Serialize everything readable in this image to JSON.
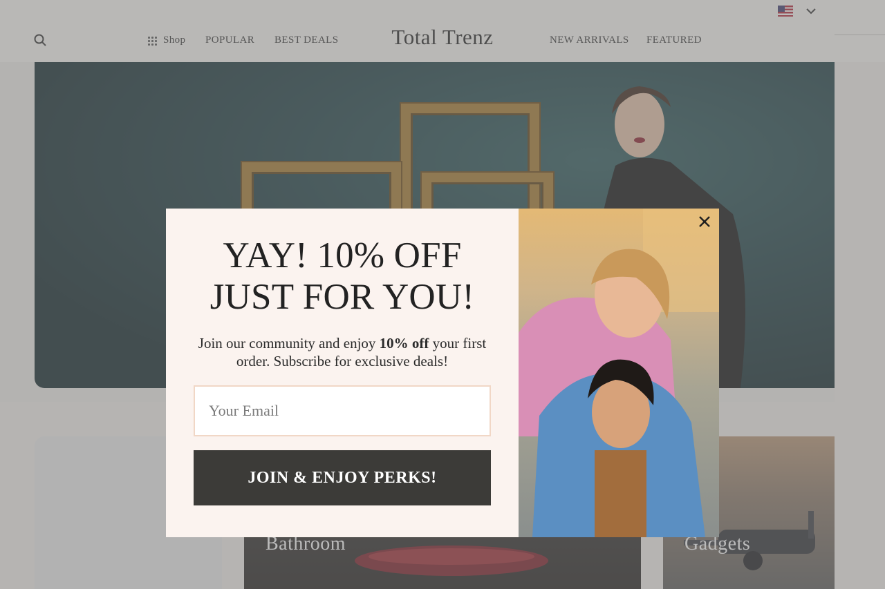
{
  "header": {
    "brand": "Total Trenz",
    "nav_left": [
      {
        "label": "Shop",
        "icon": "grid-icon"
      },
      {
        "label": "POPULAR"
      },
      {
        "label": "BEST DEALS"
      }
    ],
    "nav_right": [
      {
        "label": "NEW ARRIVALS"
      },
      {
        "label": "FEATURED"
      }
    ],
    "search_icon": "search-icon",
    "locale_icon": "us-flag-icon"
  },
  "categories": [
    {
      "label": ""
    },
    {
      "label": "Bathroom"
    },
    {
      "label": "Gadgets"
    }
  ],
  "popup": {
    "headline_line1": "YAY! 10% OFF",
    "headline_line2": "JUST FOR YOU!",
    "sub_before": "Join our community and enjoy ",
    "sub_bold": "10% off",
    "sub_after": " your first order. Subscribe for exclusive deals!",
    "email_placeholder": "Your Email",
    "email_value": "",
    "cta_label": "JOIN & ENJOY PERKS!",
    "close_icon": "close-icon"
  },
  "colors": {
    "popup_bg": "#fbf3ef",
    "cta_bg": "#3c3b38",
    "email_border": "#f1d7c6",
    "overlay": "rgba(120,120,120,0.5)"
  }
}
